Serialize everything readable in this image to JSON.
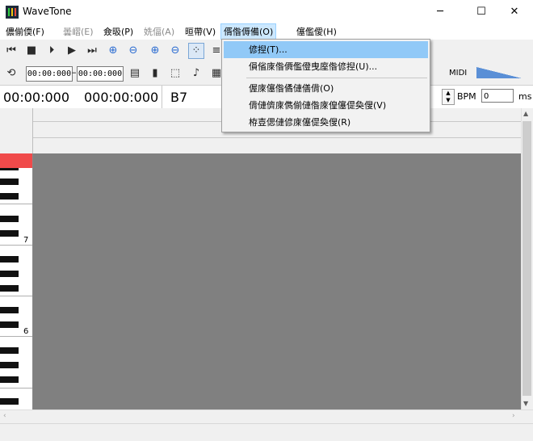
{
  "window": {
    "title": "WaveTone",
    "min": "─",
    "max": "☐",
    "close": "✕"
  },
  "menubar": [
    {
      "label": "儂偂偄(F)",
      "state": "normal"
    },
    {
      "label": "曇嶍(E)",
      "state": "disabled"
    },
    {
      "label": "僉昅(P)",
      "state": "normal"
    },
    {
      "label": "姺偪(A)",
      "state": "disabled"
    },
    {
      "label": "晅帶(V)",
      "state": "normal"
    },
    {
      "label": "偦偺傉備(O)",
      "state": "open"
    },
    {
      "label": "僿儖僾(H)",
      "state": "normal"
    }
  ],
  "dropdown": {
    "items": [
      "偐揑(T)...",
      "傊偗庲偺僲儖僜曳庢偺偐揑(U)...",
      "偓庲僿偺僪僆僐偝(O)",
      "偝僆儕庲儁偂僆偺庲偟僿偍奐傁(V)",
      "栫壴偲僆偐庲僿偍奐傁(R)"
    ]
  },
  "toolbar2": {
    "time_start": "00:00:000",
    "time_end": "00:00:000",
    "dash": "–",
    "midi_label": "MIDI"
  },
  "timerow": {
    "time1": "00:00:000",
    "time2": "000:00:000",
    "note": "B7",
    "bpm_label": "BPM",
    "bpm_value": "0",
    "ms_label": "ms"
  },
  "keyboard": {
    "octave_labels": [
      "7",
      "6"
    ]
  },
  "colors": {
    "canvas": "#808080",
    "keyboard_top": "#f04a4a",
    "menu_highlight": "#91c9f7",
    "menu_open": "#cce8ff"
  }
}
